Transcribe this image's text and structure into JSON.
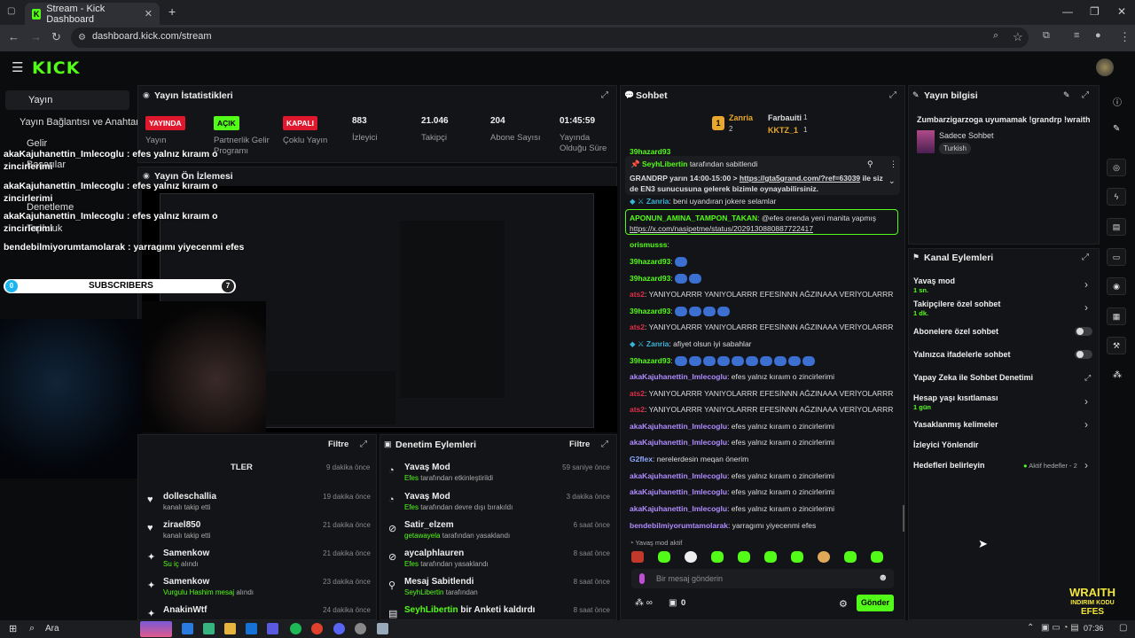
{
  "browser": {
    "tab_title": "Stream - Kick Dashboard",
    "url": "dashboard.kick.com/stream"
  },
  "header": {
    "logo": "KICK"
  },
  "sidebar": {
    "items": [
      {
        "label": "Yayın"
      },
      {
        "label": "Yayın Bağlantısı ve Anahtarı"
      },
      {
        "label": "Gelir"
      },
      {
        "label": "Başarılar"
      },
      {
        "label": "Denetleme"
      },
      {
        "label": "Topluluk"
      }
    ]
  },
  "overlay": {
    "lines": [
      "akaKajuhanettin_Imlecoglu : efes yalnız kıraım o",
      "zincirlerimi",
      "akaKajuhanettin_Imlecoglu : efes yalnız kıraım o",
      "zincirlerimi",
      "akaKajuhanettin_Imlecoglu : efes yalnız kıraım o",
      "zincirlerimi",
      "bendebilmiyorumtamolarak : yarragımı yiyecenmi efes"
    ],
    "sub_count": "0",
    "sub_label": "SUBSCRIBERS",
    "sub_goal": "7",
    "brand_top": "WRAITH",
    "brand_mid": "INDIRIM KODU",
    "brand_bot": "EFES"
  },
  "stats": {
    "title": "Yayın İstatistikleri",
    "items": [
      {
        "badge": "YAYINDA",
        "label": "Yayın"
      },
      {
        "badge": "AÇIK",
        "label": "Partnerlik Gelir Programı"
      },
      {
        "badge": "KAPALI",
        "label": "Çoklu Yayın"
      },
      {
        "value": "883",
        "label": "İzleyici"
      },
      {
        "value": "21.046",
        "label": "Takipçi"
      },
      {
        "value": "204",
        "label": "Abone Sayısı"
      },
      {
        "value": "01:45:59",
        "label": "Yayında Olduğu Süre"
      }
    ]
  },
  "preview": {
    "title": "Yayın Ön İzlemesi"
  },
  "activity": {
    "filter": "Filtre",
    "partial_header": "TLER",
    "partial_time": "9 dakika önce",
    "rows": [
      {
        "name": "dolleschallia",
        "sub": "kanalı takip etti",
        "time": "19 dakika önce"
      },
      {
        "name": "zirael850",
        "sub": "kanalı takip etti",
        "time": "21 dakika önce"
      },
      {
        "name": "Samenkow",
        "sub": "Su iç",
        "sub2": "alındı",
        "time": "21 dakika önce"
      },
      {
        "name": "Samenkow",
        "sub": "Vurgulu Hashim mesaj",
        "sub2": "alındı",
        "time": "23 dakika önce"
      },
      {
        "name": "AnakinWtf",
        "sub": "",
        "time": "24 dakika önce"
      }
    ]
  },
  "modlog": {
    "title": "Denetim Eylemleri",
    "filter": "Filtre",
    "rows": [
      {
        "name": "Yavaş Mod",
        "who": "Efes",
        "sub": "tarafından etkinleştirildi",
        "time": "59 saniye önce"
      },
      {
        "name": "Yavaş Mod",
        "who": "Efes",
        "sub": "tarafından devre dışı bırakıldı",
        "time": "3 dakika önce"
      },
      {
        "name": "Satir_elzem",
        "who": "getawayela",
        "sub": "tarafından yasaklandı",
        "time": "6 saat önce"
      },
      {
        "name": "aycalphlauren",
        "who": "Efes",
        "sub": "tarafından yasaklandı",
        "time": "8 saat önce"
      },
      {
        "name": "Mesaj Sabitlendi",
        "who": "SeyhLibertin",
        "sub": "tarafından",
        "time": "8 saat önce"
      },
      {
        "name": "SeyhLibertin",
        "who": "",
        "sub": "bir Anketi kaldırdı",
        "time": "8 saat önce"
      }
    ]
  },
  "chat": {
    "title": "Sohbet",
    "leaders": [
      {
        "rank": "1",
        "name": "Zanria",
        "count": "2"
      },
      {
        "name": "Farbauiti",
        "count": "1"
      },
      {
        "name": "KKTZ_1",
        "count": "1"
      }
    ],
    "pinned_by": "SeyhLibertin",
    "pinned_by_suffix": "tarafından sabitlendi",
    "pinned_text": "GRANDRP yarın 14:00-15:00 >",
    "pinned_link": "https://gta5grand.com/?ref=63039",
    "pinned_text2": "ile",
    "pinned_text3": "siz de EN3 sunucusuna gelerek bizimle oynayabilirsiniz.",
    "messages": [
      {
        "user": "39hazard93",
        "text": "",
        "color": "#53fc18"
      },
      {
        "user": "Zanria",
        "text": ": beni uyandıran jokere selamlar",
        "color": "#3bb2d8"
      },
      {
        "user": "APONUN_AMINA_TAMPON_TAKAN",
        "text": ": @efes orenda yeni manita yapmış",
        "color": "#53fc18",
        "link": "https://x.com/nasipetme/status/2029130880887722417"
      },
      {
        "user": "orismusss",
        "text": ":",
        "color": "#53fc18"
      },
      {
        "user": "39hazard93",
        "text": ":",
        "color": "#53fc18"
      },
      {
        "user": "39hazard93",
        "text": ":",
        "color": "#53fc18"
      },
      {
        "user": "ats2",
        "text": ": YANIYOLARRR YANIYOLARRR EFESİNNN AĞZINAAA VERİYOLARRR",
        "color": "#e0304a"
      },
      {
        "user": "39hazard93",
        "text": ":",
        "color": "#53fc18"
      },
      {
        "user": "ats2",
        "text": ": YANIYOLARRR YANIYOLARRR EFESİNNN AĞZINAAA VERİYOLARRR",
        "color": "#e0304a"
      },
      {
        "user": "Zanria",
        "text": ": afiyet olsun iyi sabahlar",
        "color": "#3bb2d8"
      },
      {
        "user": "39hazard93",
        "text": ":",
        "color": "#53fc18"
      },
      {
        "user": "akaKajuhanettin_Imlecoglu",
        "text": ": efes yalnız kıraım o zincirlerimi",
        "color": "#b08cff"
      },
      {
        "user": "ats2",
        "text": ": YANIYOLARRR YANIYOLARRR EFESİNNN AĞZINAAA VERİYOLARRR",
        "color": "#e0304a"
      },
      {
        "user": "ats2",
        "text": ": YANIYOLARRR YANIYOLARRR EFESİNNN AĞZINAAA VERİYOLARRR",
        "color": "#e0304a"
      },
      {
        "user": "akaKajuhanettin_Imlecoglu",
        "text": ": efes yalnız kıraım o zincirlerimi",
        "color": "#b08cff"
      },
      {
        "user": "akaKajuhanettin_Imlecoglu",
        "text": ": efes yalnız kıraım o zincirlerimi",
        "color": "#b08cff"
      },
      {
        "user": "G2flex",
        "text": ": nerelerdesin meqan önerim",
        "color": "#8fa8ff"
      },
      {
        "user": "akaKajuhanettin_Imlecoglu",
        "text": ": efes yalnız kıraım o zincirlerimi",
        "color": "#b08cff"
      },
      {
        "user": "akaKajuhanettin_Imlecoglu",
        "text": ": efes yalnız kıraım o zincirlerimi",
        "color": "#b08cff"
      },
      {
        "user": "akaKajuhanettin_Imlecoglu",
        "text": ": efes yalnız kıraım o zincirlerimi",
        "color": "#b08cff"
      },
      {
        "user": "bendebilmiyorumtamolarak",
        "text": ": yarragımı yiyecenmi efes",
        "color": "#b08cff"
      }
    ],
    "slow_mode": "Yavaş mod aktif",
    "placeholder": "Bir mesaj gönderin",
    "points": "0",
    "send": "Gönder"
  },
  "info": {
    "title": "Yayın bilgisi",
    "stream_title": "Zumbarzigarzoga uyumamak !grandrp !wraith",
    "category": "Sadece Sohbet",
    "tag": "Turkish"
  },
  "actions": {
    "title": "Kanal Eylemleri",
    "rows": [
      {
        "label": "Yavaş mod",
        "sub": "1 sn."
      },
      {
        "label": "Takipçilere özel sohbet",
        "sub": "1 dk."
      },
      {
        "label": "Abonelere özel sohbet",
        "sub": ""
      },
      {
        "label": "Yalnızca ifadelerle sohbet",
        "sub": ""
      },
      {
        "label": "Yapay Zeka ile Sohbet Denetimi",
        "sub": ""
      },
      {
        "label": "Hesap yaşı kısıtlaması",
        "sub": "1 gün"
      },
      {
        "label": "Yasaklanmış kelimeler",
        "sub": ""
      },
      {
        "label": "İzleyici Yönlendir",
        "sub": ""
      },
      {
        "label": "Hedefleri belirleyin",
        "sub": ""
      }
    ],
    "goals_status": "Aktif hedefler - 2"
  },
  "taskbar": {
    "search": "Ara",
    "clock": "07:36"
  },
  "colors": {
    "accent": "#53fc18",
    "live": "#e0182d",
    "bg": "#0b0c0e",
    "panel": "#131417"
  }
}
